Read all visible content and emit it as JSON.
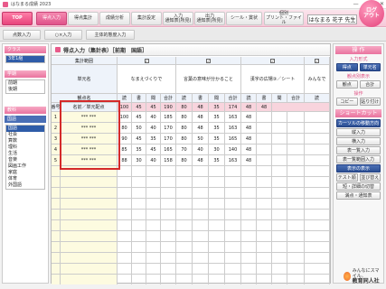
{
  "window": {
    "title": "はなまる成績 2023"
  },
  "topnav": {
    "top": "TOP",
    "tabs": [
      "得点入力",
      "得点集計",
      "成績分析",
      "集計設定",
      "入力\n通知表(所見)",
      "出力\n通知表(所見)",
      "シール・賞状",
      "個別\nプリント・ファイル"
    ],
    "user": "はなまる 花子 先生",
    "logout": "ログ\nアウト"
  },
  "subnav": [
    "点数入力",
    "○×入力",
    "主体的態度入力"
  ],
  "left": {
    "class_label": "クラス",
    "class_value": "3年1組",
    "term_label": "学期",
    "term_items": [
      "前期",
      "後期"
    ],
    "subject_label": "教科",
    "subject_sub": "国語",
    "subjects": [
      "国語",
      "社会",
      "算数",
      "理科",
      "生活",
      "音楽",
      "図画工作",
      "家庭",
      "体育",
      "外国語"
    ]
  },
  "main": {
    "title": "得点入力（集計表）［前期　国語］",
    "rows_label": "集計範囲",
    "unit_label": "単元名",
    "name_label": "観点名",
    "no_label": "番号",
    "student_label": "名前／単元配点",
    "units": [
      "なまえづくりで",
      "言葉の意味が分かること",
      "漢字の広場③／シート",
      "みんなで"
    ],
    "subhdr": [
      "読",
      "書",
      "聞",
      "合計",
      "読",
      "書",
      "聞",
      "合計",
      "読",
      "書",
      "聞",
      "合計",
      "読"
    ],
    "max_row": [
      "100",
      "45",
      "45",
      "190",
      "80",
      "48",
      "35",
      "174",
      "48",
      "48"
    ],
    "students": [
      {
        "no": "1",
        "name": "*** ***",
        "v": [
          "100",
          "45",
          "40",
          "185",
          "80",
          "48",
          "35",
          "163",
          "48"
        ]
      },
      {
        "no": "2",
        "name": "*** ***",
        "v": [
          "80",
          "50",
          "40",
          "170",
          "80",
          "48",
          "35",
          "163",
          "48"
        ]
      },
      {
        "no": "3",
        "name": "*** ***",
        "v": [
          "90",
          "45",
          "35",
          "170",
          "80",
          "50",
          "35",
          "165",
          "48"
        ]
      },
      {
        "no": "4",
        "name": "*** ***",
        "v": [
          "85",
          "35",
          "45",
          "165",
          "70",
          "40",
          "30",
          "140",
          "48"
        ]
      },
      {
        "no": "5",
        "name": "*** ***",
        "v": [
          "88",
          "30",
          "40",
          "158",
          "80",
          "48",
          "35",
          "163",
          "48"
        ]
      }
    ]
  },
  "right": {
    "ops": "操 作",
    "input_form": "入力形式",
    "form_btns": [
      "得点",
      "単元名"
    ],
    "view_label": "観点別表示",
    "view_btns": [
      "観点",
      "合計"
    ],
    "edit_label": "操作",
    "edit_btns": [
      "コピー",
      "貼り付け"
    ],
    "shortcut": "ショートカット",
    "move_label": "カーソルの移動方向",
    "move_btn": "縦入力",
    "lat": "横入力",
    "tbl1": "表一覧入力",
    "tbl2": "表一覧範囲入力",
    "disp": "表示の表示",
    "more": [
      "テスト順",
      "並び替え",
      "短・詳細の切替",
      "満点・通知表"
    ]
  },
  "brand": {
    "line1": "みんなにスマイル。",
    "line2": "教育同人社"
  }
}
